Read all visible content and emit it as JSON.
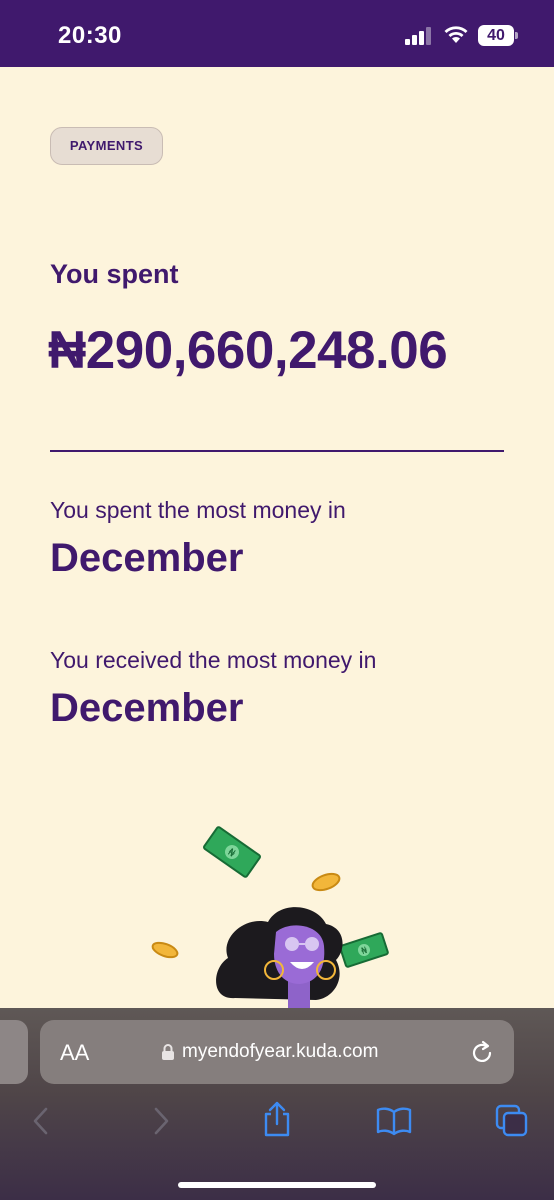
{
  "status_bar": {
    "time": "20:30",
    "battery": "40",
    "icons": [
      "signal-icon",
      "wifi-icon",
      "battery-icon"
    ]
  },
  "page": {
    "category_pill": "PAYMENTS",
    "spent_label": "You spent",
    "spent_amount": "₦290,660,248.06",
    "most_spent_caption": "You spent the most money in",
    "most_spent_month": "December",
    "most_received_caption": "You received the most money in",
    "most_received_month": "December",
    "colors": {
      "brand_purple": "#40196D",
      "background": "#FDF4DC",
      "money_green": "#2FA85A",
      "coin_gold": "#F2B63A"
    },
    "illustration": {
      "icons": [
        "banknote-icon",
        "coin-icon",
        "person-illustration"
      ],
      "banknote_symbol": "₦"
    }
  },
  "browser": {
    "text_size_button": "AA",
    "url": "myendofyear.kuda.com",
    "icons": [
      "lock-icon",
      "reload-icon",
      "back-icon",
      "forward-icon",
      "share-icon",
      "bookmarks-icon",
      "tabs-icon"
    ]
  }
}
